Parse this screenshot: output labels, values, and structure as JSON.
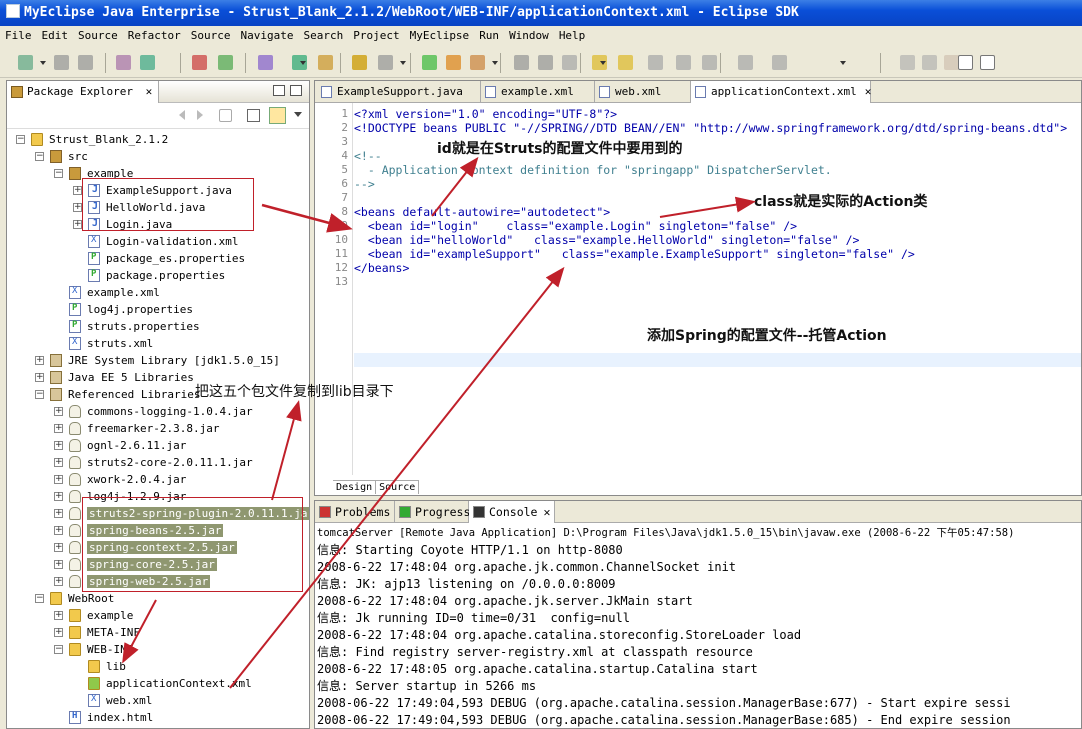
{
  "window": {
    "title": "MyEclipse Java Enterprise - Strust_Blank_2.1.2/WebRoot/WEB-INF/applicationContext.xml - Eclipse SDK"
  },
  "menu": [
    "File",
    "Edit",
    "Source",
    "Refactor",
    "Source",
    "Navigate",
    "Search",
    "Project",
    "MyEclipse",
    "Run",
    "Window",
    "Help"
  ],
  "package_explorer": {
    "title": "Package Explorer",
    "close": "✕",
    "tree": [
      {
        "label": "Strust_Blank_2.1.2",
        "indent": 0,
        "icon": "project-icon",
        "exp": "−"
      },
      {
        "label": "src",
        "indent": 1,
        "icon": "source-folder-icon",
        "exp": "−"
      },
      {
        "label": "example",
        "indent": 2,
        "icon": "package-icon",
        "exp": "−"
      },
      {
        "label": "ExampleSupport.java",
        "indent": 3,
        "icon": "java-file-icon",
        "exp": "+"
      },
      {
        "label": "HelloWorld.java",
        "indent": 3,
        "icon": "java-file-icon",
        "exp": "+"
      },
      {
        "label": "Login.java",
        "indent": 3,
        "icon": "java-file-icon",
        "exp": "+"
      },
      {
        "label": "Login-validation.xml",
        "indent": 3,
        "icon": "xml-file-icon",
        "exp": ""
      },
      {
        "label": "package_es.properties",
        "indent": 3,
        "icon": "properties-file-icon",
        "exp": ""
      },
      {
        "label": "package.properties",
        "indent": 3,
        "icon": "properties-file-icon",
        "exp": ""
      },
      {
        "label": "example.xml",
        "indent": 2,
        "icon": "xml-file-icon",
        "exp": ""
      },
      {
        "label": "log4j.properties",
        "indent": 2,
        "icon": "properties-file-icon",
        "exp": ""
      },
      {
        "label": "struts.properties",
        "indent": 2,
        "icon": "properties-file-icon",
        "exp": ""
      },
      {
        "label": "struts.xml",
        "indent": 2,
        "icon": "xml-file-icon",
        "exp": ""
      },
      {
        "label": "JRE System Library [jdk1.5.0_15]",
        "indent": 1,
        "icon": "library-icon",
        "exp": "+"
      },
      {
        "label": "Java EE 5 Libraries",
        "indent": 1,
        "icon": "library-icon",
        "exp": "+"
      },
      {
        "label": "Referenced Libraries",
        "indent": 1,
        "icon": "library-icon",
        "exp": "−"
      },
      {
        "label": "commons-logging-1.0.4.jar",
        "indent": 2,
        "icon": "jar-icon",
        "exp": "+"
      },
      {
        "label": "freemarker-2.3.8.jar",
        "indent": 2,
        "icon": "jar-icon",
        "exp": "+"
      },
      {
        "label": "ognl-2.6.11.jar",
        "indent": 2,
        "icon": "jar-icon",
        "exp": "+"
      },
      {
        "label": "struts2-core-2.0.11.1.jar",
        "indent": 2,
        "icon": "jar-icon",
        "exp": "+"
      },
      {
        "label": "xwork-2.0.4.jar",
        "indent": 2,
        "icon": "jar-icon",
        "exp": "+"
      },
      {
        "label": "log4j-1.2.9.jar",
        "indent": 2,
        "icon": "jar-icon",
        "exp": "+"
      },
      {
        "label": "struts2-spring-plugin-2.0.11.1.jar",
        "indent": 2,
        "icon": "jar-icon",
        "exp": "+",
        "selected": true
      },
      {
        "label": "spring-beans-2.5.jar",
        "indent": 2,
        "icon": "jar-icon",
        "exp": "+",
        "selected": true
      },
      {
        "label": "spring-context-2.5.jar",
        "indent": 2,
        "icon": "jar-icon",
        "exp": "+",
        "selected": true
      },
      {
        "label": "spring-core-2.5.jar",
        "indent": 2,
        "icon": "jar-icon",
        "exp": "+",
        "selected": true
      },
      {
        "label": "spring-web-2.5.jar",
        "indent": 2,
        "icon": "jar-icon",
        "exp": "+",
        "selected": true
      },
      {
        "label": "WebRoot",
        "indent": 1,
        "icon": "folder-icon",
        "exp": "−"
      },
      {
        "label": "example",
        "indent": 2,
        "icon": "folder-icon",
        "exp": "+"
      },
      {
        "label": "META-INF",
        "indent": 2,
        "icon": "folder-icon",
        "exp": "+"
      },
      {
        "label": "WEB-INF",
        "indent": 2,
        "icon": "folder-icon",
        "exp": "−"
      },
      {
        "label": "lib",
        "indent": 3,
        "icon": "folder-icon",
        "exp": ""
      },
      {
        "label": "applicationContext.xml",
        "indent": 3,
        "icon": "spring-config-icon",
        "exp": ""
      },
      {
        "label": "web.xml",
        "indent": 3,
        "icon": "xml-file-icon",
        "exp": ""
      },
      {
        "label": "index.html",
        "indent": 2,
        "icon": "html-file-icon",
        "exp": ""
      }
    ]
  },
  "editor": {
    "tabs": [
      {
        "label": "ExampleSupport.java",
        "active": false
      },
      {
        "label": "example.xml",
        "active": false
      },
      {
        "label": "web.xml",
        "active": false
      },
      {
        "label": "applicationContext.xml",
        "active": true
      }
    ],
    "close": "✕",
    "lines": [
      "<?xml version=\"1.0\" encoding=\"UTF-8\"?>",
      "<!DOCTYPE beans PUBLIC \"-//SPRING//DTD BEAN//EN\" \"http://www.springframework.org/dtd/spring-beans.dtd\">",
      "",
      "<!--",
      "  - Application context definition for \"springapp\" DispatcherServlet.",
      "-->",
      "",
      "<beans default-autowire=\"autodetect\">",
      "  <bean id=\"login\"    class=\"example.Login\" singleton=\"false\" />",
      "  <bean id=\"helloWorld\"   class=\"example.HelloWorld\" singleton=\"false\" />",
      "  <bean id=\"exampleSupport\"   class=\"example.ExampleSupport\" singleton=\"false\" />",
      "</beans>",
      ""
    ],
    "bottom_tabs": [
      "Design",
      "Source"
    ]
  },
  "console": {
    "tabs": [
      {
        "label": "Problems",
        "active": false
      },
      {
        "label": "Progress",
        "active": false
      },
      {
        "label": "Console",
        "active": true
      }
    ],
    "process": "tomcatServer [Remote Java Application] D:\\Program Files\\Java\\jdk1.5.0_15\\bin\\javaw.exe (2008-6-22 下午05:47:58)",
    "lines": [
      "信息: Starting Coyote HTTP/1.1 on http-8080",
      "2008-6-22 17:48:04 org.apache.jk.common.ChannelSocket init",
      "信息: JK: ajp13 listening on /0.0.0.0:8009",
      "2008-6-22 17:48:04 org.apache.jk.server.JkMain start",
      "信息: Jk running ID=0 time=0/31  config=null",
      "2008-6-22 17:48:04 org.apache.catalina.storeconfig.StoreLoader load",
      "信息: Find registry server-registry.xml at classpath resource",
      "2008-6-22 17:48:05 org.apache.catalina.startup.Catalina start",
      "信息: Server startup in 5266 ms",
      "2008-06-22 17:49:04,593 DEBUG (org.apache.catalina.session.ManagerBase:677) - Start expire sessi",
      "2008-06-22 17:49:04,593 DEBUG (org.apache.catalina.session.ManagerBase:685) - End expire session"
    ]
  },
  "annotations": {
    "id_note": "id就是在Struts的配置文件中要用到的",
    "class_note": "class就是实际的Action类",
    "spring_note": "添加Spring的配置文件--托管Action",
    "lib_note": "把这五个包文件复制到lib目录下"
  },
  "colors": {
    "arrow": "#c0202a",
    "title_bar": "#0a4fd8",
    "selection": "#8f9770"
  }
}
